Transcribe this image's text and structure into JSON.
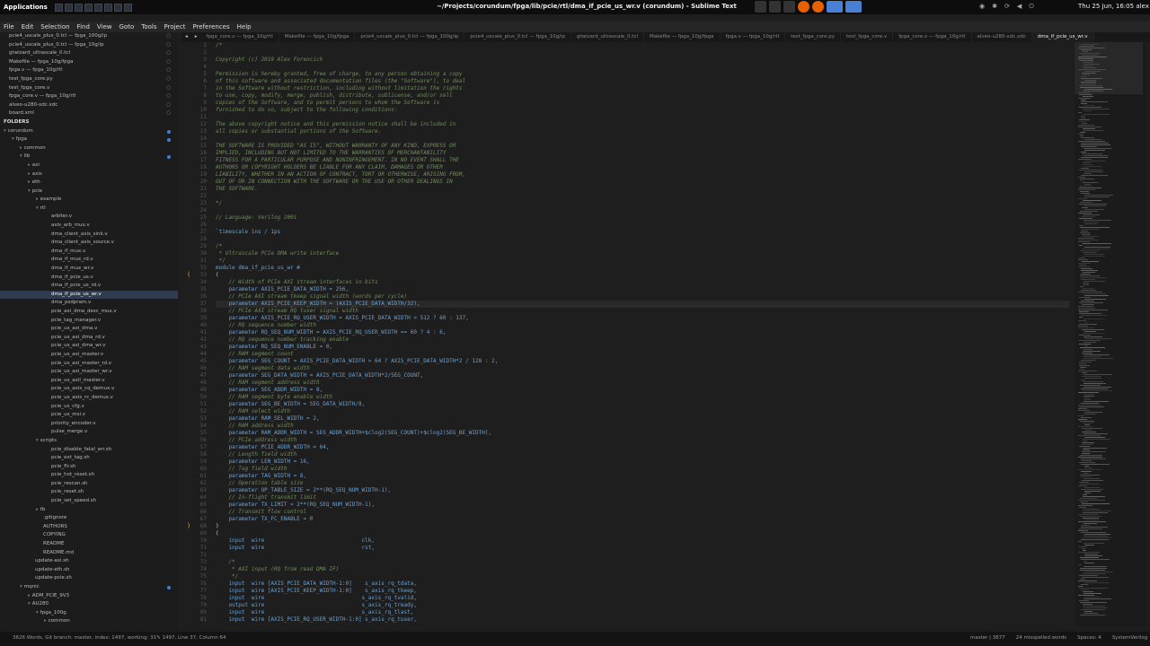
{
  "topbar": {
    "apps_label": "Applications",
    "window_title": "~/Projects/corundum/fpga/lib/pcie/rtl/dma_if_pcie_us_wr.v (corundum) - Sublime Text",
    "clock": "Thu 25 Jun, 16:05",
    "user": "alex"
  },
  "menu": [
    "File",
    "Edit",
    "Selection",
    "Find",
    "View",
    "Goto",
    "Tools",
    "Project",
    "Preferences",
    "Help"
  ],
  "sidebar": {
    "open_files": [
      "pcie4_uscale_plus_0.tcl — fpga_100g/ip",
      "pcie4_uscale_plus_0.tcl — fpga_10g/ip",
      "gtwizard_ultrascale_0.tcl",
      "Makefile — fpga_10g/fpga",
      "fpga.v — fpga_10g/rtl",
      "test_fpga_core.py",
      "test_fpga_core.v",
      "fpga_core.v — fpga_10g/rtl",
      "alveo-u280-xdc.xdc",
      "board.xml"
    ],
    "folders_label": "FOLDERS",
    "tree": [
      {
        "t": "corundum",
        "i": 0,
        "o": true
      },
      {
        "t": "fpga",
        "i": 1,
        "o": true
      },
      {
        "t": "common",
        "i": 2,
        "o": false
      },
      {
        "t": "lib",
        "i": 2,
        "o": true
      },
      {
        "t": "axi",
        "i": 3,
        "o": false
      },
      {
        "t": "axis",
        "i": 3,
        "o": false
      },
      {
        "t": "eth",
        "i": 3,
        "o": false
      },
      {
        "t": "pcie",
        "i": 3,
        "o": true
      },
      {
        "t": "example",
        "i": 4,
        "o": false
      },
      {
        "t": "rtl",
        "i": 4,
        "o": true
      },
      {
        "t": "arbiter.v",
        "i": 5
      },
      {
        "t": "axis_arb_mux.v",
        "i": 5
      },
      {
        "t": "dma_client_axis_sink.v",
        "i": 5
      },
      {
        "t": "dma_client_axis_source.v",
        "i": 5
      },
      {
        "t": "dma_if_mux.v",
        "i": 5
      },
      {
        "t": "dma_if_mux_rd.v",
        "i": 5
      },
      {
        "t": "dma_if_mux_wr.v",
        "i": 5
      },
      {
        "t": "dma_if_pcie_us.v",
        "i": 5
      },
      {
        "t": "dma_if_pcie_us_rd.v",
        "i": 5
      },
      {
        "t": "dma_if_pcie_us_wr.v",
        "i": 5,
        "sel": true
      },
      {
        "t": "dma_psdpram.v",
        "i": 5
      },
      {
        "t": "pcie_axi_dma_desc_mux.v",
        "i": 5
      },
      {
        "t": "pcie_tag_manager.v",
        "i": 5
      },
      {
        "t": "pcie_us_axi_dma.v",
        "i": 5
      },
      {
        "t": "pcie_us_axi_dma_rd.v",
        "i": 5
      },
      {
        "t": "pcie_us_axi_dma_wr.v",
        "i": 5
      },
      {
        "t": "pcie_us_axi_master.v",
        "i": 5
      },
      {
        "t": "pcie_us_axi_master_rd.v",
        "i": 5
      },
      {
        "t": "pcie_us_axi_master_wr.v",
        "i": 5
      },
      {
        "t": "pcie_us_axil_master.v",
        "i": 5
      },
      {
        "t": "pcie_us_axis_cq_demux.v",
        "i": 5
      },
      {
        "t": "pcie_us_axis_rc_demux.v",
        "i": 5
      },
      {
        "t": "pcie_us_cfg.v",
        "i": 5
      },
      {
        "t": "pcie_us_msi.v",
        "i": 5
      },
      {
        "t": "priority_encoder.v",
        "i": 5
      },
      {
        "t": "pulse_merge.v",
        "i": 5
      },
      {
        "t": "scripts",
        "i": 4,
        "o": true
      },
      {
        "t": "pcie_disable_fatal_err.sh",
        "i": 5
      },
      {
        "t": "pcie_ext_tag.sh",
        "i": 5
      },
      {
        "t": "pcie_flr.sh",
        "i": 5
      },
      {
        "t": "pcie_hot_reset.sh",
        "i": 5
      },
      {
        "t": "pcie_rescan.sh",
        "i": 5
      },
      {
        "t": "pcie_reset.sh",
        "i": 5
      },
      {
        "t": "pcie_set_speed.sh",
        "i": 5
      },
      {
        "t": "tb",
        "i": 4,
        "o": false
      },
      {
        "t": ".gitignore",
        "i": 4
      },
      {
        "t": "AUTHORS",
        "i": 4
      },
      {
        "t": "COPYING",
        "i": 4
      },
      {
        "t": "README",
        "i": 4
      },
      {
        "t": "README.md",
        "i": 4
      },
      {
        "t": "update-axi.sh",
        "i": 3
      },
      {
        "t": "update-eth.sh",
        "i": 3
      },
      {
        "t": "update-pcie.sh",
        "i": 3
      },
      {
        "t": "mqnic",
        "i": 2,
        "o": true
      },
      {
        "t": "ADM_PCIE_9V3",
        "i": 3,
        "o": false
      },
      {
        "t": "AU280",
        "i": 3,
        "o": true
      },
      {
        "t": "fpga_100g",
        "i": 4,
        "o": true
      },
      {
        "t": "common",
        "i": 5,
        "o": false
      }
    ]
  },
  "tabs": [
    "fpga_core.v — fpga_10g/rtl",
    "Makefile — fpga_10g/fpga",
    "pcie4_uscale_plus_0.tcl — fpga_100g/ip",
    "pcie4_uscale_plus_0.tcl — fpga_10g/ip",
    "gtwizard_ultrascale_0.tcl",
    "Makefile — fpga_10g/fpga",
    "fpga.v — fpga_10g/rtl",
    "test_fpga_core.py",
    "test_fpga_core.v",
    "fpga_core.v — fpga_10g/rtl",
    "alveo-u280-xdc.xdc",
    "dma_if_pcie_us_wr.v"
  ],
  "editor": {
    "start_line": 1,
    "cursor_line": 37,
    "lines": [
      {
        "k": "comment",
        "t": "/*"
      },
      {
        "k": "comment",
        "t": ""
      },
      {
        "k": "comment",
        "t": "Copyright (c) 2019 Alex Forencich"
      },
      {
        "k": "comment",
        "t": ""
      },
      {
        "k": "comment",
        "t": "Permission is hereby granted, free of charge, to any person obtaining a copy"
      },
      {
        "k": "comment",
        "t": "of this software and associated documentation files (the \"Software\"), to deal"
      },
      {
        "k": "comment",
        "t": "in the Software without restriction, including without limitation the rights"
      },
      {
        "k": "comment",
        "t": "to use, copy, modify, merge, publish, distribute, sublicense, and/or sell"
      },
      {
        "k": "comment",
        "t": "copies of the Software, and to permit persons to whom the Software is"
      },
      {
        "k": "comment",
        "t": "furnished to do so, subject to the following conditions:"
      },
      {
        "k": "comment",
        "t": ""
      },
      {
        "k": "comment",
        "t": "The above copyright notice and this permission notice shall be included in"
      },
      {
        "k": "comment",
        "t": "all copies or substantial portions of the Software."
      },
      {
        "k": "comment",
        "t": ""
      },
      {
        "k": "comment",
        "t": "THE SOFTWARE IS PROVIDED \"AS IS\", WITHOUT WARRANTY OF ANY KIND, EXPRESS OR"
      },
      {
        "k": "comment",
        "t": "IMPLIED, INCLUDING BUT NOT LIMITED TO THE WARRANTIES OF MERCHANTABILITY"
      },
      {
        "k": "comment",
        "t": "FITNESS FOR A PARTICULAR PURPOSE AND NONINFRINGEMENT. IN NO EVENT SHALL THE"
      },
      {
        "k": "comment",
        "t": "AUTHORS OR COPYRIGHT HOLDERS BE LIABLE FOR ANY CLAIM, DAMAGES OR OTHER"
      },
      {
        "k": "comment",
        "t": "LIABILITY, WHETHER IN AN ACTION OF CONTRACT, TORT OR OTHERWISE, ARISING FROM,"
      },
      {
        "k": "comment",
        "t": "OUT OF OR IN CONNECTION WITH THE SOFTWARE OR THE USE OR OTHER DEALINGS IN"
      },
      {
        "k": "comment",
        "t": "THE SOFTWARE."
      },
      {
        "k": "comment",
        "t": ""
      },
      {
        "k": "comment",
        "t": "*/"
      },
      {
        "k": "plain",
        "t": ""
      },
      {
        "k": "comment",
        "t": "// Language: Verilog 2001"
      },
      {
        "k": "plain",
        "t": ""
      },
      {
        "k": "code",
        "t": "`timescale 1ns / 1ps"
      },
      {
        "k": "plain",
        "t": ""
      },
      {
        "k": "comment",
        "t": "/*"
      },
      {
        "k": "comment",
        "t": " * Ultrascale PCIe DMA write interface"
      },
      {
        "k": "comment",
        "t": " */"
      },
      {
        "k": "code",
        "t": "module dma_if_pcie_us_wr #"
      },
      {
        "k": "plain",
        "t": "("
      },
      {
        "k": "comment",
        "t": "    // Width of PCIe AXI stream interfaces in bits"
      },
      {
        "k": "code",
        "t": "    parameter AXIS_PCIE_DATA_WIDTH = 256,"
      },
      {
        "k": "comment",
        "t": "    // PCIe AXI stream tkeep signal width (words per cycle)"
      },
      {
        "k": "code",
        "t": "    parameter AXIS_PCIE_KEEP_WIDTH = (AXIS_PCIE_DATA_WIDTH/32),"
      },
      {
        "k": "comment",
        "t": "    // PCIe AXI stream RQ tuser signal width"
      },
      {
        "k": "code",
        "t": "    parameter AXIS_PCIE_RQ_USER_WIDTH = AXIS_PCIE_DATA_WIDTH < 512 ? 60 : 137,"
      },
      {
        "k": "comment",
        "t": "    // RQ sequence number width"
      },
      {
        "k": "code",
        "t": "    parameter RQ_SEQ_NUM_WIDTH = AXIS_PCIE_RQ_USER_WIDTH == 60 ? 4 : 6,"
      },
      {
        "k": "comment",
        "t": "    // RQ sequence number tracking enable"
      },
      {
        "k": "code",
        "t": "    parameter RQ_SEQ_NUM_ENABLE = 0,"
      },
      {
        "k": "comment",
        "t": "    // RAM segment count"
      },
      {
        "k": "code",
        "t": "    parameter SEG_COUNT = AXIS_PCIE_DATA_WIDTH > 64 ? AXIS_PCIE_DATA_WIDTH*2 / 128 : 2,"
      },
      {
        "k": "comment",
        "t": "    // RAM segment data width"
      },
      {
        "k": "code",
        "t": "    parameter SEG_DATA_WIDTH = AXIS_PCIE_DATA_WIDTH*2/SEG_COUNT,"
      },
      {
        "k": "comment",
        "t": "    // RAM segment address width"
      },
      {
        "k": "code",
        "t": "    parameter SEG_ADDR_WIDTH = 8,"
      },
      {
        "k": "comment",
        "t": "    // RAM segment byte enable width"
      },
      {
        "k": "code",
        "t": "    parameter SEG_BE_WIDTH = SEG_DATA_WIDTH/8,"
      },
      {
        "k": "comment",
        "t": "    // RAM select width"
      },
      {
        "k": "code",
        "t": "    parameter RAM_SEL_WIDTH = 2,"
      },
      {
        "k": "comment",
        "t": "    // RAM address width"
      },
      {
        "k": "code",
        "t": "    parameter RAM_ADDR_WIDTH = SEG_ADDR_WIDTH+$clog2(SEG_COUNT)+$clog2(SEG_BE_WIDTH),"
      },
      {
        "k": "comment",
        "t": "    // PCIe address width"
      },
      {
        "k": "code",
        "t": "    parameter PCIE_ADDR_WIDTH = 64,"
      },
      {
        "k": "comment",
        "t": "    // Length field width"
      },
      {
        "k": "code",
        "t": "    parameter LEN_WIDTH = 16,"
      },
      {
        "k": "comment",
        "t": "    // Tag field width"
      },
      {
        "k": "code",
        "t": "    parameter TAG_WIDTH = 8,"
      },
      {
        "k": "comment",
        "t": "    // Operation table size"
      },
      {
        "k": "code",
        "t": "    parameter OP_TABLE_SIZE = 2**(RQ_SEQ_NUM_WIDTH-1),"
      },
      {
        "k": "comment",
        "t": "    // In-flight transmit limit"
      },
      {
        "k": "code",
        "t": "    parameter TX_LIMIT = 2**(RQ_SEQ_NUM_WIDTH-1),"
      },
      {
        "k": "comment",
        "t": "    // Transmit flow control"
      },
      {
        "k": "code",
        "t": "    parameter TX_FC_ENABLE = 0"
      },
      {
        "k": "plain",
        "t": ")"
      },
      {
        "k": "plain",
        "t": "("
      },
      {
        "k": "code",
        "t": "    input  wire                              clk,"
      },
      {
        "k": "code",
        "t": "    input  wire                              rst,"
      },
      {
        "k": "plain",
        "t": ""
      },
      {
        "k": "comment",
        "t": "    /*"
      },
      {
        "k": "comment",
        "t": "     * AXI input (RQ from read DMA IF)"
      },
      {
        "k": "comment",
        "t": "     */"
      },
      {
        "k": "code",
        "t": "    input  wire [AXIS_PCIE_DATA_WIDTH-1:0]    s_axis_rq_tdata,"
      },
      {
        "k": "code",
        "t": "    input  wire [AXIS_PCIE_KEEP_WIDTH-1:0]    s_axis_rq_tkeep,"
      },
      {
        "k": "code",
        "t": "    input  wire                              s_axis_rq_tvalid,"
      },
      {
        "k": "code",
        "t": "    output wire                              s_axis_rq_tready,"
      },
      {
        "k": "code",
        "t": "    input  wire                              s_axis_rq_tlast,"
      },
      {
        "k": "code",
        "t": "    input  wire [AXIS_PCIE_RQ_USER_WIDTH-1:0] s_axis_rq_tuser,"
      }
    ]
  },
  "statusbar": {
    "left": "3626 Words, Git branch: master, index: 1497, working: 31✎ 1497, Line 37, Column 64",
    "branch": "master",
    "branch_count": "3677",
    "misspelled": "24 misspelled words",
    "spaces": "Spaces: 4",
    "syntax": "SystemVerilog"
  },
  "colors": {
    "comment": "#6f8d56",
    "code": "#66a2d6",
    "accent": "#3b82d6",
    "fold_marker": "#d8b12a"
  }
}
